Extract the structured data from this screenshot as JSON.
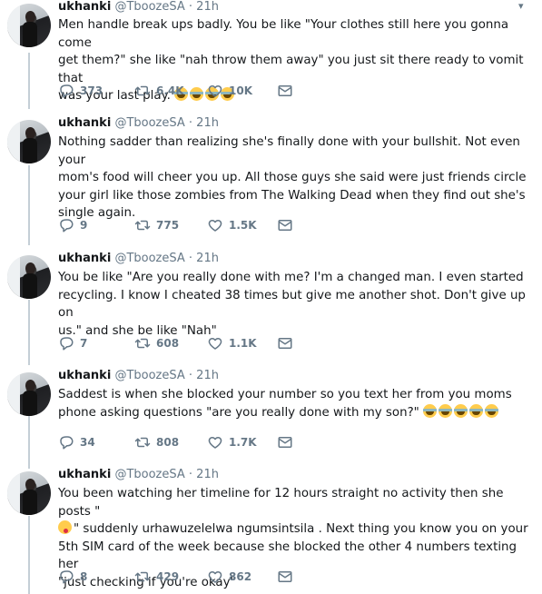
{
  "tweets": [
    {
      "name": "ukhanki",
      "handle": "@TboozeSA",
      "dot": "·",
      "time": "21h",
      "lines": [
        "Men handle break ups badly. You be like \"Your clothes still here you gonna come",
        "get them?\" she like \"nah throw them away\" you just sit there ready to vomit that",
        "was your last play."
      ],
      "trailing_emoji": [
        "tears-of-joy",
        "tears-of-joy",
        "tears-of-joy",
        "tears-of-joy"
      ],
      "replies": "373",
      "retweets": "6.4K",
      "likes": "10K"
    },
    {
      "name": "ukhanki",
      "handle": "@TboozeSA",
      "dot": "·",
      "time": "21h",
      "lines": [
        "Nothing sadder than realizing she's finally done with your bullshit. Not even your",
        "mom's food will cheer you up. All those guys she said were just friends circle",
        "your girl like those zombies from The Walking Dead when they find out she's",
        "single again."
      ],
      "trailing_emoji": [],
      "replies": "9",
      "retweets": "775",
      "likes": "1.5K"
    },
    {
      "name": "ukhanki",
      "handle": "@TboozeSA",
      "dot": "·",
      "time": "21h",
      "lines": [
        "You be like \"Are you really done with me? I'm a changed man. I even started",
        "recycling. I know I cheated 38 times but give me another shot. Don't give up on",
        "us.\" and she be like \"Nah\""
      ],
      "trailing_emoji": [],
      "replies": "7",
      "retweets": "608",
      "likes": "1.1K"
    },
    {
      "name": "ukhanki",
      "handle": "@TboozeSA",
      "dot": "·",
      "time": "21h",
      "lines": [
        "Saddest is when she blocked your number so you text her from you moms",
        "phone asking questions \"are you really done with my son?\""
      ],
      "trailing_emoji": [
        "tears-of-joy",
        "tears-of-joy",
        "tears-of-joy",
        "tears-of-joy",
        "tears-of-joy"
      ],
      "replies": "34",
      "retweets": "808",
      "likes": "1.7K"
    },
    {
      "name": "ukhanki",
      "handle": "@TboozeSA",
      "dot": "·",
      "time": "21h",
      "lines": [
        "You been watching her timeline for 12 hours straight no activity then she posts \"",
        "\" suddenly urhawuzelelwa ngumsintsila . Next thing you know you on your",
        "5th SIM card of the week because she blocked the other 4 numbers texting her",
        "\"just checking if you're okay\""
      ],
      "line2_leading_emoji": "face-savoring-food",
      "trailing_emoji": [],
      "replies": "8",
      "retweets": "429",
      "likes": "862"
    }
  ],
  "icons": {
    "caret": "chevron-down-icon",
    "reply": "reply-icon",
    "retweet": "retweet-icon",
    "like": "heart-icon",
    "dm": "envelope-icon"
  },
  "colors": {
    "text": "#14171a",
    "muted": "#657786",
    "thread_line": "#c4cfd6"
  }
}
